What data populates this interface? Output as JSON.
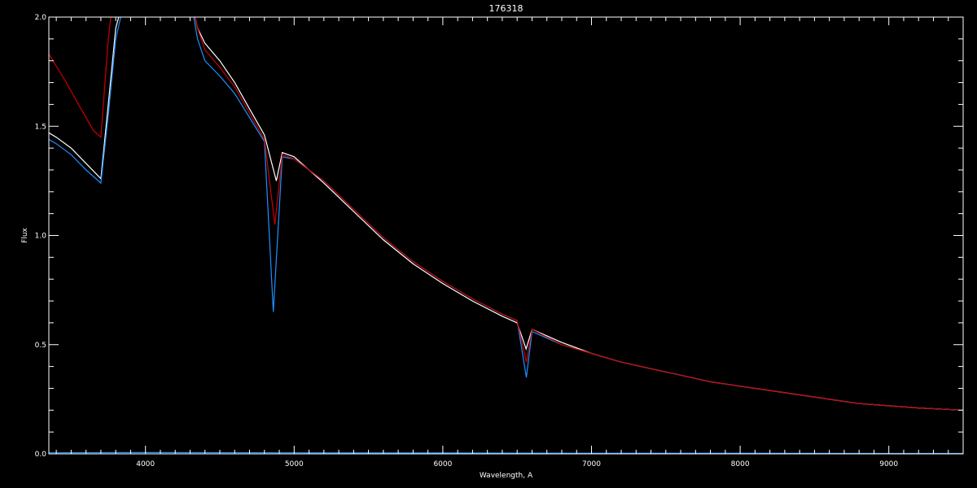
{
  "chart_data": {
    "type": "line",
    "title": "176318",
    "xlabel": "Wavelength, A",
    "ylabel": "Flux",
    "xlim": [
      3350,
      9500
    ],
    "ylim": [
      0,
      2.0
    ],
    "x_ticks": [
      4000,
      5000,
      6000,
      7000,
      8000,
      9000
    ],
    "y_ticks": [
      "0.0",
      "0.5",
      "1.0",
      "1.5",
      "2.0"
    ],
    "grid": false,
    "background_color": "#000000",
    "axis_color": "#ffffff",
    "series": [
      {
        "color": "#ffffff",
        "points": [
          [
            3350,
            1.47
          ],
          [
            3400,
            1.45
          ],
          [
            3500,
            1.4
          ],
          [
            3600,
            1.33
          ],
          [
            3700,
            1.26
          ],
          [
            3750,
            1.6
          ],
          [
            3800,
            1.95
          ],
          [
            3900,
            2.2
          ],
          [
            4000,
            2.3
          ],
          [
            4100,
            2.3
          ],
          [
            4200,
            2.25
          ],
          [
            4300,
            2.1
          ],
          [
            4350,
            1.95
          ],
          [
            4400,
            1.88
          ],
          [
            4500,
            1.8
          ],
          [
            4600,
            1.7
          ],
          [
            4700,
            1.58
          ],
          [
            4800,
            1.46
          ],
          [
            4880,
            1.25
          ],
          [
            4920,
            1.38
          ],
          [
            5000,
            1.36
          ],
          [
            5200,
            1.24
          ],
          [
            5400,
            1.11
          ],
          [
            5600,
            0.98
          ],
          [
            5800,
            0.87
          ],
          [
            6000,
            0.78
          ],
          [
            6200,
            0.7
          ],
          [
            6400,
            0.63
          ],
          [
            6500,
            0.6
          ],
          [
            6560,
            0.48
          ],
          [
            6600,
            0.57
          ],
          [
            6800,
            0.51
          ],
          [
            7000,
            0.46
          ],
          [
            7200,
            0.42
          ],
          [
            7400,
            0.39
          ],
          [
            7600,
            0.36
          ],
          [
            7800,
            0.33
          ],
          [
            8000,
            0.31
          ],
          [
            8200,
            0.29
          ],
          [
            8400,
            0.27
          ],
          [
            8600,
            0.25
          ],
          [
            8800,
            0.23
          ],
          [
            9000,
            0.22
          ],
          [
            9200,
            0.21
          ],
          [
            9500,
            0.2
          ]
        ]
      },
      {
        "color": "#1e90ff",
        "points": [
          [
            3350,
            1.44
          ],
          [
            3400,
            1.42
          ],
          [
            3500,
            1.37
          ],
          [
            3600,
            1.3
          ],
          [
            3700,
            1.24
          ],
          [
            3750,
            1.55
          ],
          [
            3800,
            1.9
          ],
          [
            3900,
            2.2
          ],
          [
            4000,
            2.3
          ],
          [
            4100,
            2.3
          ],
          [
            4200,
            2.25
          ],
          [
            4300,
            2.1
          ],
          [
            4350,
            1.9
          ],
          [
            4400,
            1.8
          ],
          [
            4500,
            1.73
          ],
          [
            4600,
            1.65
          ],
          [
            4700,
            1.54
          ],
          [
            4800,
            1.43
          ],
          [
            4860,
            0.65
          ],
          [
            4920,
            1.36
          ],
          [
            5000,
            1.35
          ],
          [
            5200,
            1.25
          ],
          [
            5400,
            1.12
          ],
          [
            5600,
            0.99
          ],
          [
            5800,
            0.88
          ],
          [
            6000,
            0.79
          ],
          [
            6200,
            0.71
          ],
          [
            6400,
            0.64
          ],
          [
            6500,
            0.61
          ],
          [
            6562,
            0.35
          ],
          [
            6600,
            0.56
          ],
          [
            6800,
            0.5
          ],
          [
            7000,
            0.46
          ],
          [
            7200,
            0.42
          ],
          [
            7400,
            0.39
          ],
          [
            7600,
            0.36
          ],
          [
            7800,
            0.33
          ],
          [
            8000,
            0.31
          ],
          [
            8200,
            0.29
          ],
          [
            8400,
            0.27
          ],
          [
            8600,
            0.25
          ],
          [
            8800,
            0.23
          ],
          [
            9000,
            0.22
          ],
          [
            9200,
            0.21
          ],
          [
            9500,
            0.2
          ]
        ]
      },
      {
        "color": "#cc0000",
        "points": [
          [
            3350,
            1.83
          ],
          [
            3450,
            1.72
          ],
          [
            3550,
            1.6
          ],
          [
            3650,
            1.48
          ],
          [
            3700,
            1.45
          ],
          [
            3750,
            1.9
          ],
          [
            3800,
            2.2
          ],
          [
            3900,
            2.3
          ],
          [
            4000,
            2.3
          ],
          [
            4100,
            2.3
          ],
          [
            4200,
            2.25
          ],
          [
            4300,
            2.1
          ],
          [
            4350,
            1.95
          ],
          [
            4400,
            1.85
          ],
          [
            4500,
            1.77
          ],
          [
            4600,
            1.68
          ],
          [
            4700,
            1.56
          ],
          [
            4800,
            1.44
          ],
          [
            4870,
            1.05
          ],
          [
            4920,
            1.37
          ],
          [
            5000,
            1.35
          ],
          [
            5200,
            1.25
          ],
          [
            5400,
            1.12
          ],
          [
            5600,
            0.99
          ],
          [
            5800,
            0.88
          ],
          [
            6000,
            0.79
          ],
          [
            6200,
            0.71
          ],
          [
            6400,
            0.64
          ],
          [
            6500,
            0.61
          ],
          [
            6562,
            0.42
          ],
          [
            6600,
            0.57
          ],
          [
            6800,
            0.5
          ],
          [
            7000,
            0.46
          ],
          [
            7200,
            0.42
          ],
          [
            7400,
            0.39
          ],
          [
            7600,
            0.36
          ],
          [
            7800,
            0.33
          ],
          [
            8000,
            0.31
          ],
          [
            8200,
            0.29
          ],
          [
            8400,
            0.27
          ],
          [
            8600,
            0.25
          ],
          [
            8800,
            0.23
          ],
          [
            9000,
            0.22
          ],
          [
            9200,
            0.21
          ],
          [
            9500,
            0.2
          ]
        ]
      },
      {
        "color": "#1e90ff",
        "points": [
          [
            3350,
            0.005
          ],
          [
            4000,
            0.006
          ],
          [
            5000,
            0.005
          ],
          [
            6000,
            0.004
          ],
          [
            7000,
            0.003
          ],
          [
            8000,
            0.003
          ],
          [
            9000,
            0.002
          ],
          [
            9500,
            0.002
          ]
        ]
      }
    ]
  }
}
